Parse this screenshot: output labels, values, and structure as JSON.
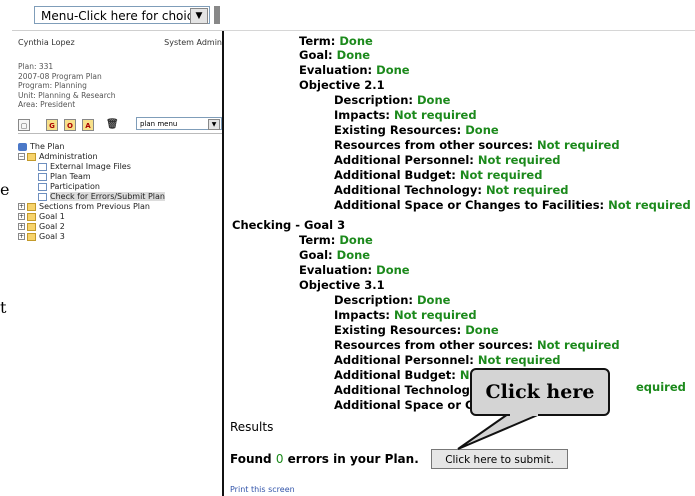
{
  "menubar": {
    "choices_label": "Menu-Click here for choices",
    "arrow": "▼"
  },
  "user": {
    "name": "Cynthia Lopez",
    "role": "System Admin"
  },
  "plan_meta": [
    "Plan: 331",
    "2007-08 Program Plan",
    "Program: Planning",
    "Unit: Planning & Research",
    "Area: President"
  ],
  "toolbar": {
    "plan_menu": "plan menu",
    "buttons": [
      "G",
      "O",
      "A"
    ]
  },
  "tree": [
    {
      "label": "The Plan",
      "level": 0,
      "icon": "plan-icon"
    },
    {
      "label": "Administration",
      "level": 1,
      "icon": "folder-icon",
      "expand": "−"
    },
    {
      "label": "External Image Files",
      "level": 2,
      "icon": "page-icon"
    },
    {
      "label": "Plan Team",
      "level": 2,
      "icon": "page-icon"
    },
    {
      "label": "Participation",
      "level": 2,
      "icon": "page-icon"
    },
    {
      "label": "Check for Errors/Submit Plan",
      "level": 2,
      "icon": "page-icon",
      "selected": true
    },
    {
      "label": "Sections from Previous Plan",
      "level": 1,
      "icon": "folder-icon",
      "expand": "+"
    },
    {
      "label": "Goal 1",
      "level": 1,
      "icon": "folder-icon",
      "expand": "+"
    },
    {
      "label": "Goal 2",
      "level": 1,
      "icon": "folder-icon",
      "expand": "+"
    },
    {
      "label": "Goal 3",
      "level": 1,
      "icon": "folder-icon",
      "expand": "+"
    }
  ],
  "checks": {
    "term": "Term:",
    "goal": "Goal:",
    "evaluation": "Evaluation:",
    "done": "Done",
    "not_required": "Not required",
    "objective_2": "Objective 2.1",
    "objective_3": "Objective 3.1",
    "checking_goal_3": "Checking - Goal 3",
    "description": "Description:",
    "impacts": "Impacts:",
    "existing_resources": "Existing Resources:",
    "resources_other": "Resources from other sources:",
    "additional_personnel": "Additional Personnel:",
    "additional_budget": "Additional Budget:",
    "additional_technology": "Additional Technology:",
    "additional_space": "Additional Space or Changes to Facilities:",
    "additional_technology_cut": "Additional Technology",
    "additional_space_cut": "Additional Space or C",
    "equired": "equired"
  },
  "results": {
    "heading": "Results",
    "found_prefix": "Found",
    "errors": "0",
    "found_suffix": "errors in your Plan.",
    "submit_label": "Click here to submit.",
    "print_label": "Print this screen"
  },
  "callout": {
    "text": "Click here"
  },
  "stray": {
    "line1": "e",
    "line2": "t"
  },
  "colors": {
    "status_green": "#1c8a1c"
  }
}
